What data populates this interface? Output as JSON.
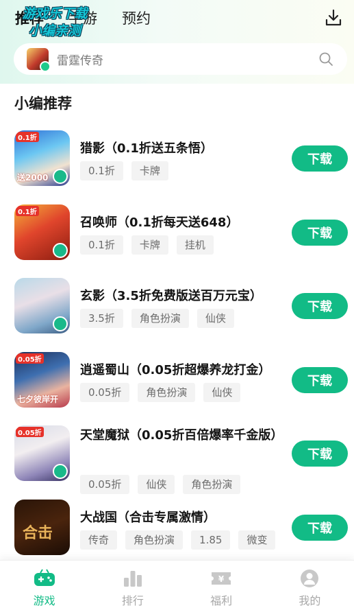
{
  "header": {
    "tabs": [
      "推荐",
      "手游",
      "预约"
    ],
    "watermark_lines": [
      "游戏乐下载",
      "小编亲测"
    ],
    "download_icon": "download-icon"
  },
  "search": {
    "placeholder": "雷霆传奇",
    "icon": "search-icon"
  },
  "section": {
    "title": "小编推荐"
  },
  "games": [
    {
      "name": "猎影（0.1折送五条悟）",
      "tags": [
        "0.1折",
        "卡牌"
      ],
      "icon_tag": "0.1折",
      "icon_bottom": "送2000",
      "button": "下载"
    },
    {
      "name": "召唤师（0.1折每天送648）",
      "tags": [
        "0.1折",
        "卡牌",
        "挂机"
      ],
      "icon_tag": "0.1折",
      "icon_bottom": "",
      "button": "下载"
    },
    {
      "name": "玄影（3.5折免费版送百万元宝）",
      "tags": [
        "3.5折",
        "角色扮演",
        "仙侠"
      ],
      "icon_tag": "",
      "icon_bottom": "",
      "button": "下载"
    },
    {
      "name": "逍遥蜀山（0.05折超爆养龙打金）",
      "tags": [
        "0.05折",
        "角色扮演",
        "仙侠"
      ],
      "icon_tag": "0.05折",
      "icon_bottom": "七夕彼岸开",
      "button": "下载"
    },
    {
      "name": "天堂魔狱（0.05折百倍爆率千金版）",
      "tags": [
        "0.05折",
        "仙侠",
        "角色扮演"
      ],
      "icon_tag": "0.05折",
      "icon_bottom": "",
      "button": "下载"
    },
    {
      "name": "大战国（合击专属激情）",
      "tags": [
        "传奇",
        "角色扮演",
        "1.85",
        "微变"
      ],
      "icon_tag": "",
      "icon_bottom": "合击",
      "button": "下载"
    }
  ],
  "bottom_nav": [
    {
      "label": "游戏",
      "icon": "gamepad-icon",
      "active": true
    },
    {
      "label": "排行",
      "icon": "bar-chart-icon",
      "active": false
    },
    {
      "label": "福利",
      "icon": "ticket-icon",
      "active": false
    },
    {
      "label": "我的",
      "icon": "user-icon",
      "active": false
    }
  ],
  "colors": {
    "accent": "#12bb86",
    "tag_bg": "#f3f3f3",
    "inactive_nav": "#a8a8a8"
  }
}
